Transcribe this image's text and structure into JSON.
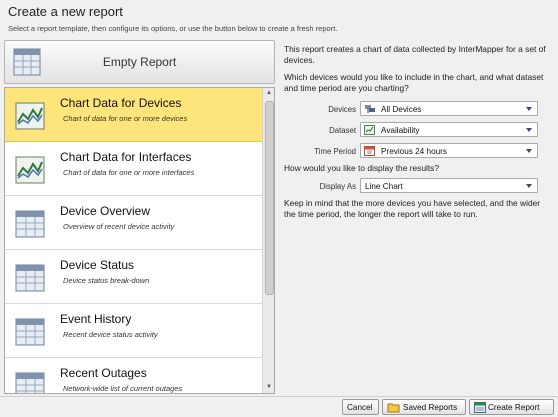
{
  "header": {
    "title": "Create a new report",
    "subtitle": "Select a report template, then configure its options, or use the button below to create a fresh report."
  },
  "empty_report": {
    "label": "Empty Report",
    "icon": "grid-report-icon"
  },
  "templates": [
    {
      "name": "Chart Data for Devices",
      "description": "Chart of data for one or more devices",
      "icon": "chart-report-icon",
      "selected": true
    },
    {
      "name": "Chart Data for Interfaces",
      "description": "Chart of data for one or more interfaces",
      "icon": "chart-report-icon",
      "selected": false
    },
    {
      "name": "Device Overview",
      "description": "Overview of recent device activity",
      "icon": "grid-report-icon",
      "selected": false
    },
    {
      "name": "Device Status",
      "description": "Device status break-down",
      "icon": "grid-report-icon",
      "selected": false
    },
    {
      "name": "Event History",
      "description": "Recent device status activity",
      "icon": "grid-report-icon",
      "selected": false
    },
    {
      "name": "Recent Outages",
      "description": "Network-wide list of current outages",
      "icon": "grid-report-icon",
      "selected": false
    }
  ],
  "details": {
    "intro": "This report creates a chart of data collected by InterMapper for a set of devices.",
    "question1": "Which devices would you like to include in the chart, and what dataset and time period are you charting?",
    "fields": [
      {
        "label": "Devices",
        "value": "All Devices",
        "icon": "devices-icon"
      },
      {
        "label": "Dataset",
        "value": "Availability",
        "icon": "dataset-icon"
      },
      {
        "label": "Time Period",
        "value": "Previous 24 hours",
        "icon": "calendar-icon"
      }
    ],
    "question2": "How would you like to display the results?",
    "display": {
      "label": "Display As",
      "value": "Line Chart"
    },
    "note": "Keep in mind that the more devices you have selected, and the wider the time period, the longer the report will take to run."
  },
  "footer": {
    "cancel": "Cancel",
    "saved_reports": "Saved Reports",
    "create_report": "Create Report"
  },
  "colors": {
    "selected_bg": "#fee57b",
    "window_bg": "#f0f0f0"
  }
}
